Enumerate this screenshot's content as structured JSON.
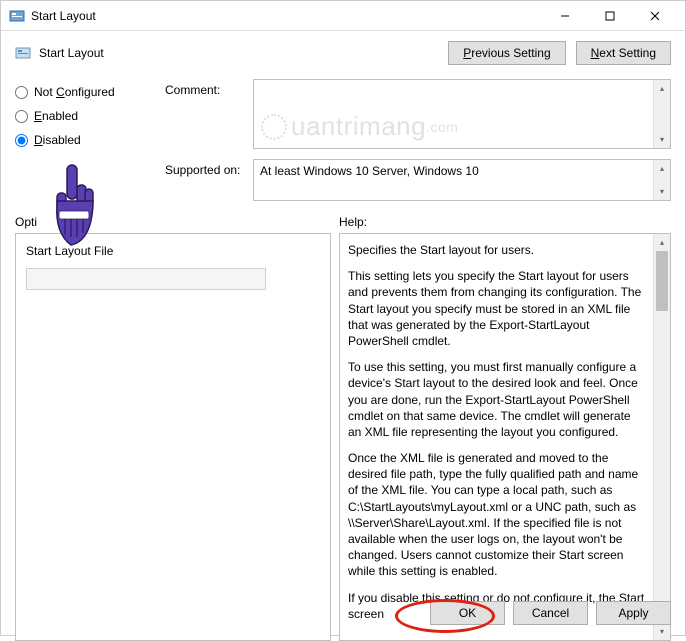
{
  "window": {
    "title": "Start Layout"
  },
  "header": {
    "title": "Start Layout",
    "prev_label": "Previous Setting",
    "next_label": "Next Setting"
  },
  "radios": {
    "not_configured": "Not Configured",
    "enabled": "Enabled",
    "disabled": "Disabled",
    "selected": "disabled"
  },
  "fields": {
    "comment_label": "Comment:",
    "comment_value": "",
    "supported_label": "Supported on:",
    "supported_value": "At least Windows 10 Server, Windows 10"
  },
  "panels": {
    "options_label": "Options:",
    "help_label": "Help:",
    "option_field_label": "Start Layout File",
    "option_field_value": ""
  },
  "help_text": {
    "p1": "Specifies the Start layout for users.",
    "p2": "This setting lets you specify the Start layout for users and prevents them from changing its configuration. The Start layout you specify must be stored in an XML file that was generated by the Export-StartLayout PowerShell cmdlet.",
    "p3": "To use this setting, you must first manually configure a device's Start layout to the desired look and feel. Once you are done, run the Export-StartLayout PowerShell cmdlet on that same device. The cmdlet will generate an XML file representing the layout you configured.",
    "p4": "Once the XML file is generated and moved to the desired file path, type the fully qualified path and name of the XML file. You can type a local path, such as C:\\StartLayouts\\myLayout.xml or a UNC path, such as \\\\Server\\Share\\Layout.xml. If the specified file is not available when the user logs on, the layout won't be changed. Users cannot customize their Start screen while this setting is enabled.",
    "p5": "If you disable this setting or do not configure it, the Start screen"
  },
  "footer": {
    "ok": "OK",
    "cancel": "Cancel",
    "apply": "Apply"
  },
  "watermark": "uantrimang"
}
